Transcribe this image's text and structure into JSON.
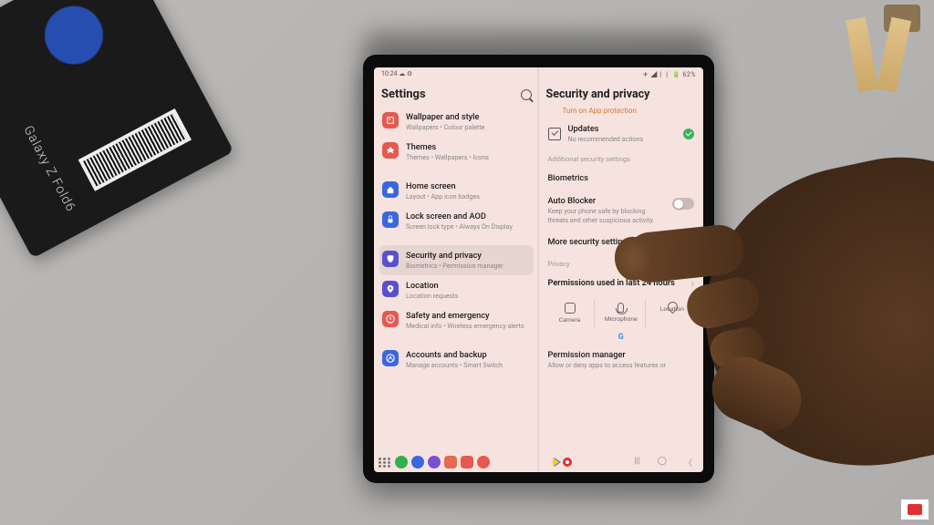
{
  "statusbar": {
    "time": "10:24",
    "indicators_left": "☁ ⚙",
    "indicators_right": "✈ ◢ㅣㅣ 🔋 62%"
  },
  "left_pane": {
    "title": "Settings",
    "items": [
      {
        "label": "Wallpaper and style",
        "sub": "Wallpapers • Colour palette",
        "color": "#e5594f",
        "icon": "wallpaper"
      },
      {
        "label": "Themes",
        "sub": "Themes • Wallpapers • Icons",
        "color": "#e5594f",
        "icon": "themes"
      },
      {
        "label": "Home screen",
        "sub": "Layout • App icon badges",
        "color": "#3a66e0",
        "icon": "home"
      },
      {
        "label": "Lock screen and AOD",
        "sub": "Screen lock type • Always On Display",
        "color": "#3a66e0",
        "icon": "lock"
      },
      {
        "label": "Security and privacy",
        "sub": "Biometrics • Permission manager",
        "color": "#5a4fd0",
        "icon": "shield",
        "selected": true
      },
      {
        "label": "Location",
        "sub": "Location requests",
        "color": "#5a4fd0",
        "icon": "location"
      },
      {
        "label": "Safety and emergency",
        "sub": "Medical info • Wireless emergency alerts",
        "color": "#e5594f",
        "icon": "safety"
      },
      {
        "label": "Accounts and backup",
        "sub": "Manage accounts • Smart Switch",
        "color": "#3a66e0",
        "icon": "accounts"
      }
    ]
  },
  "right_pane": {
    "title": "Security and privacy",
    "turn_on": "Turn on App protection",
    "updates": {
      "label": "Updates",
      "sub": "No recommended actions"
    },
    "section1": "Additional security settings",
    "biometrics": "Biometrics",
    "auto_blocker": {
      "label": "Auto Blocker",
      "sub": "Keep your phone safe by blocking threats and other suspicious activity."
    },
    "more_security": "More security settings",
    "section2": "Privacy",
    "perm_24h": "Permissions used in last 24 hours",
    "perm_cards": {
      "camera": "Camera",
      "microphone": "Microphone",
      "location": "Location"
    },
    "perm_manager": {
      "label": "Permission manager",
      "sub": "Allow or deny apps to access features or"
    }
  },
  "box_text": "Galaxy Z Fold6"
}
